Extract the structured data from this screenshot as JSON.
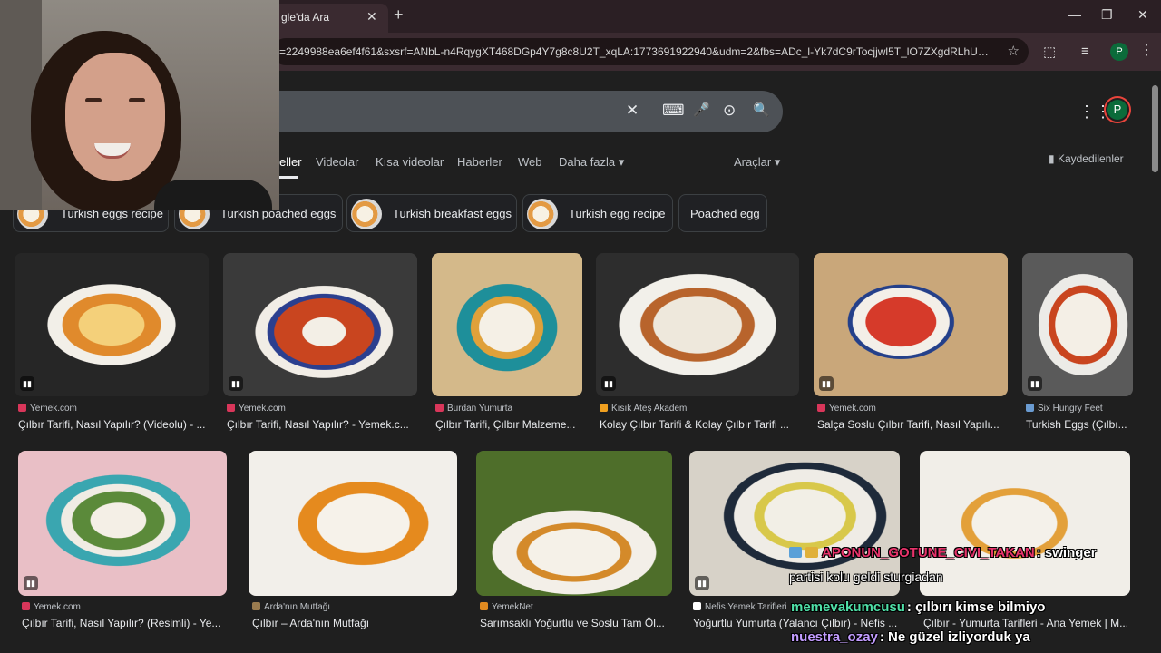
{
  "browser": {
    "tab_title": "gle'da Ara",
    "tab_close": "✕",
    "new_tab": "+",
    "minimize": "—",
    "maximize": "❐",
    "close": "✕",
    "url": "=2249988ea6ef4f61&sxsrf=ANbL-n4RqygXT468DGp4Y7g8c8U2T_xqLA:1773691922940&udm=2&fbs=ADc_l-Yk7dC9rTocjjwl5T_lO7ZXgdRLhUG8pk-pM0...",
    "profile_initial": "P"
  },
  "search": {
    "clear": "✕",
    "keyboard": "⌨",
    "mic": "🎤",
    "lens": "⊙",
    "search": "🔍",
    "apps": "⋮⋮⋮",
    "avatar": "P"
  },
  "nav": {
    "tabs": [
      "eller",
      "Videolar",
      "Kısa videolar",
      "Haberler",
      "Web",
      "Daha fazla ▾"
    ],
    "tools": "Araçlar ▾",
    "saved": "Kaydedilenler"
  },
  "chips": [
    "Turkish eggs recipe",
    "Turkish poached eggs",
    "Turkish breakfast eggs",
    "Turkish egg recipe",
    "Poached egg"
  ],
  "results_row1": [
    {
      "source": "Yemek.com",
      "title": "Çılbır Tarifi, Nasıl Yapılır? (Videolu) - ...",
      "fav": "#d9365a"
    },
    {
      "source": "Yemek.com",
      "title": "Çılbır Tarifi, Nasıl Yapılır? - Yemek.c...",
      "fav": "#d9365a"
    },
    {
      "source": "Burdan Yumurta",
      "title": "Çılbır Tarifi, Çılbır Malzeme...",
      "fav": "#d9365a"
    },
    {
      "source": "Kısık Ateş Akademi",
      "title": "Kolay Çılbır Tarifi & Kolay Çılbır Tarifi ...",
      "fav": "#f0a020"
    },
    {
      "source": "Yemek.com",
      "title": "Salça Soslu Çılbır Tarifi, Nasıl Yapılı...",
      "fav": "#d9365a"
    },
    {
      "source": "Six Hungry Feet",
      "title": "Turkish Eggs (Çılbı...",
      "fav": "#6a9bd1"
    }
  ],
  "results_row2": [
    {
      "source": "Yemek.com",
      "title": "Çılbır Tarifi, Nasıl Yapılır? (Resimli) - Ye...",
      "fav": "#d9365a"
    },
    {
      "source": "Arda'nın Mutfağı",
      "title": "Çılbır – Arda'nın Mutfağı",
      "fav": "#9a7b4f"
    },
    {
      "source": "YemekNet",
      "title": "Sarımsaklı Yoğurtlu ve Soslu Tam Öl...",
      "fav": "#e08a20"
    },
    {
      "source": "Nefis Yemek Tarifleri",
      "title": "Yoğurtlu Yumurta (Yalancı Çılbır) - Nefis ...",
      "fav": "#ffffff"
    },
    {
      "source": "",
      "title": "Çılbır - Yumurta Tarifleri - Ana Yemek | M...",
      "fav": "#d9365a"
    }
  ],
  "chat": [
    {
      "user": "APONUN_GOTUNE_CIVI_TAKAN",
      "message": ": swinger",
      "color": "#e8336b"
    },
    {
      "user": "",
      "message": "partisi kolu geldi sturgiadan",
      "color": "#ffffff"
    },
    {
      "user": "memevakumcusu",
      "message": ": çılbırı kimse bilmiyo",
      "color": "#4fe0a8"
    },
    {
      "user": "nuestra_ozay",
      "message": ": Ne güzel izliyorduk ya",
      "color": "#c29cff"
    }
  ]
}
